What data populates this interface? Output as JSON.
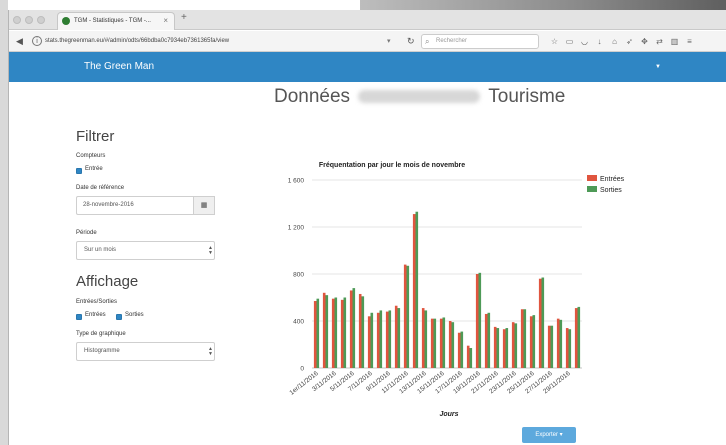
{
  "browser": {
    "tab_title": "TGM - Statistiques - TGM -...",
    "tab_close": "×",
    "new_tab": "+",
    "url": "stats.thegreenman.eu/#/admin/odts/66bdba0c7934eb7361365fa/view",
    "search_placeholder": "Rechercher"
  },
  "app": {
    "brand": "The Green Man",
    "page_title_prefix": "Données",
    "page_title_suffix": "Tourisme",
    "colors": {
      "header": "#2f86c4",
      "entrees": "#e0553f",
      "sorties": "#4e9a57",
      "export": "#5da9dd"
    }
  },
  "filter": {
    "title": "Filtrer",
    "counters_label": "Compteurs",
    "counter_entree": "Entrée",
    "date_label": "Date de référence",
    "date_value": "28-novembre-2016",
    "period_label": "Période",
    "period_value": "Sur un mois"
  },
  "display": {
    "title": "Affichage",
    "io_label": "Entrées/Sorties",
    "in_label": "Entrées",
    "out_label": "Sorties",
    "charttype_label": "Type de graphique",
    "charttype_value": "Histogramme"
  },
  "export_label": "Exporter ▾",
  "chart_data": {
    "type": "bar",
    "title": "Fréquentation par jour le mois de novembre",
    "xlabel": "Jours",
    "ylabel": "",
    "ylim": [
      0,
      1600
    ],
    "yticks": [
      0,
      400,
      800,
      1200,
      1600
    ],
    "yticklabels": [
      "0",
      "400",
      "800",
      "1 200",
      "1 600"
    ],
    "grid": true,
    "legend": "top-right",
    "categories": [
      "1er/11/2016",
      "2/11/2016",
      "3/11/2016",
      "4/11/2016",
      "5/11/2016",
      "6/11/2016",
      "7/11/2016",
      "8/11/2016",
      "9/11/2016",
      "10/11/2016",
      "11/11/2016",
      "12/11/2016",
      "13/11/2016",
      "14/11/2016",
      "15/11/2016",
      "16/11/2016",
      "17/11/2016",
      "18/11/2016",
      "19/11/2016",
      "20/11/2016",
      "21/11/2016",
      "22/11/2016",
      "23/11/2016",
      "24/11/2016",
      "25/11/2016",
      "26/11/2016",
      "27/11/2016",
      "28/11/2016",
      "29/11/2016",
      "30/11/2016"
    ],
    "tick_labels_shown": [
      "1er/11/2016",
      "3/11/2016",
      "5/11/2016",
      "7/11/2016",
      "9/11/2016",
      "11/11/2016",
      "13/11/2016",
      "15/11/2016",
      "17/11/2016",
      "19/11/2016",
      "21/11/2016",
      "23/11/2016",
      "25/11/2016",
      "27/11/2016",
      "29/11/2016"
    ],
    "series": [
      {
        "name": "Entrées",
        "color": "#e0553f",
        "values": [
          570,
          640,
          590,
          580,
          660,
          630,
          440,
          470,
          480,
          530,
          880,
          1310,
          510,
          420,
          420,
          400,
          300,
          190,
          800,
          460,
          350,
          330,
          390,
          500,
          440,
          760,
          360,
          420,
          340,
          510
        ]
      },
      {
        "name": "Sorties",
        "color": "#4e9a57",
        "values": [
          590,
          620,
          600,
          600,
          680,
          610,
          470,
          490,
          490,
          510,
          870,
          1330,
          490,
          420,
          430,
          390,
          310,
          170,
          810,
          470,
          340,
          340,
          380,
          500,
          450,
          770,
          360,
          410,
          330,
          520
        ]
      }
    ]
  }
}
